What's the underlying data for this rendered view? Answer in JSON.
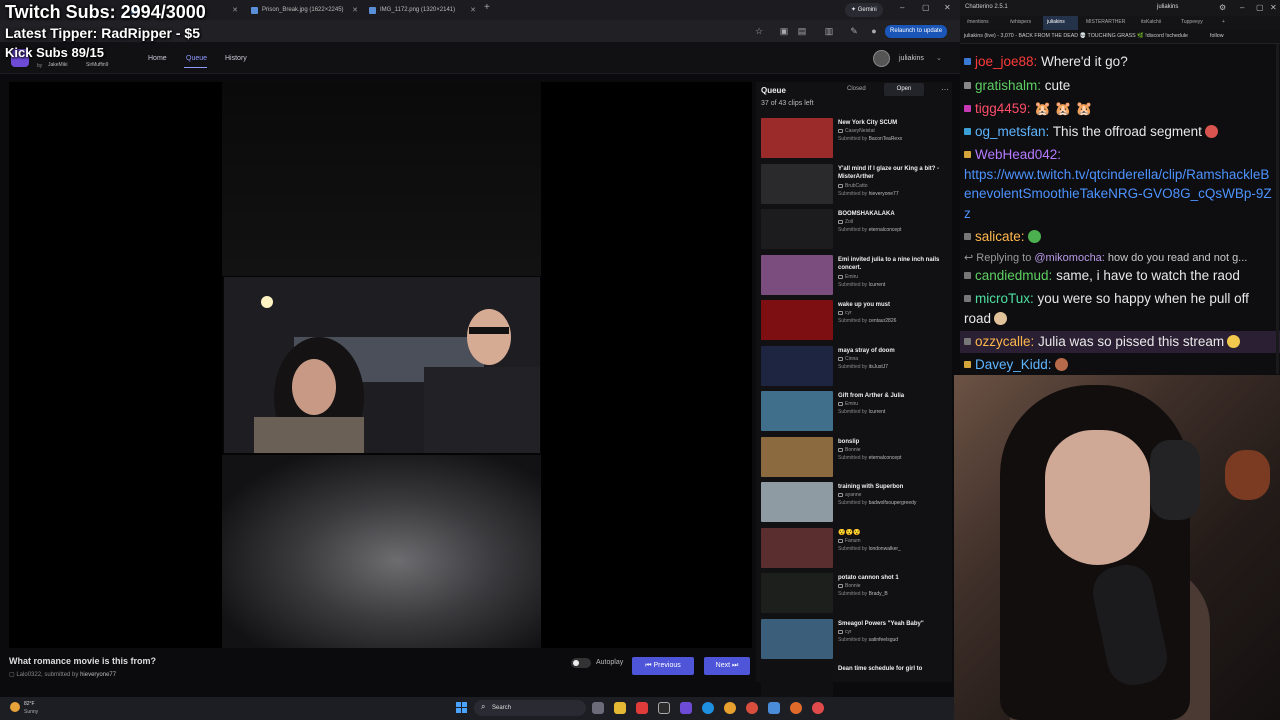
{
  "browser": {
    "tabs": [
      {
        "label": ""
      },
      {
        "label": "Prison_Break.jpg (1622×2245)"
      },
      {
        "label": "IMG_1172.png (1320×2141)"
      }
    ],
    "gemini_label": "Gemini",
    "relaunch_label": "Relaunch to update"
  },
  "overlay": {
    "subs": "Twitch Subs: 2994/3000",
    "tipper": "Latest Tipper: RadRipper - $5",
    "kick": "Kick Subs 89/15"
  },
  "app": {
    "by_label": "by",
    "by_users": [
      "JakeMiki",
      "SirMuffin9"
    ],
    "nav": [
      "Home",
      "Queue",
      "History"
    ],
    "username": "juliakins"
  },
  "clip": {
    "title": "What romance movie is this from?",
    "author": "Lalo0322",
    "submitted_by_label": ", submitted by",
    "submitter": "hieveryone77",
    "autoplay_label": "Autoplay",
    "previous_label": "Previous",
    "next_label": "Next"
  },
  "queue": {
    "title": "Queue",
    "count": "37 of 43 clips left",
    "tab_closed": "Closed",
    "tab_open": "Open",
    "submitted_label": "Submitted by",
    "items": [
      {
        "title": "New York City SCUM",
        "author": "CaseyNeistat",
        "submitter": "BaconTeaRexx",
        "color": "#9b2b2b"
      },
      {
        "title": "Y'all mind if I glaze our King a bit? - MisterArther",
        "author": "BrubCatto",
        "submitter": "hieveryone77",
        "color": "#2a2a2c"
      },
      {
        "title": "BOOMSHAKALAKA",
        "author": "Zoil",
        "submitter": "eternalconcept",
        "color": "#1c1c1e"
      },
      {
        "title": "Emi invited julia to a nine inch nails concert.",
        "author": "Emiru",
        "submitter": "lcurrent",
        "color": "#7a4d7e"
      },
      {
        "title": "wake up you must",
        "author": "cyr",
        "submitter": "centaur2826",
        "color": "#7d0f12"
      },
      {
        "title": "maya stray of doom",
        "author": "Cinna",
        "submitter": "itsJustJ7",
        "color": "#1e2540"
      },
      {
        "title": "Gift from Arther & Julia",
        "author": "Emiru",
        "submitter": "lcurrent",
        "color": "#3f6f8a"
      },
      {
        "title": "bonslip",
        "author": "Bonnie",
        "submitter": "eternalconcept",
        "color": "#8a6a3e"
      },
      {
        "title": "training with Superbon",
        "author": "ayanne",
        "submitter": "badwolfsoupergreedy",
        "color": "#8e9ba3"
      },
      {
        "title": "😯😯😯",
        "author": "Fanum",
        "submitter": "londonwalker_",
        "color": "#5a2e2e"
      },
      {
        "title": "potato cannon shot 1",
        "author": "Bonnie",
        "submitter": "Brady_B",
        "color": "#1c1f1c"
      },
      {
        "title": "Smeagol Powers \"Yeah Baby\"",
        "author": "cyr",
        "submitter": "satinfeelsgud",
        "color": "#3b5f7b"
      },
      {
        "title": "Dean time schedule for girl to",
        "author": "",
        "submitter": "",
        "color": "#101012"
      }
    ]
  },
  "taskbar": {
    "temp": "82°F",
    "condition": "Sunny",
    "search_label": "Search"
  },
  "chat": {
    "app_name": "Chatterino 2.5.1",
    "user": "juliakins",
    "tabs": [
      "/mentions",
      "/whispers",
      "juliakins",
      "MISTERARTHER",
      "itsKatchii",
      "Tuppeeyy"
    ],
    "header": "juliakins (live) - 3,070 - BACK FROM THE DEAD 💀 TOUCHING GRASS 🌿 !discord !schedule",
    "follow_label": "follow",
    "messages": [
      {
        "name": "joe_joe88:",
        "text": "Where'd it go?",
        "name_color": "#ff3b3b",
        "badge": "#3a78d6"
      },
      {
        "name": "gratishalm:",
        "text": "cute",
        "name_color": "#5ecf63",
        "badge": "#888888"
      },
      {
        "name": "tigg4459:",
        "text": "🐹 🐹 🐹",
        "name_color": "#ff4d6a",
        "badge": "#c83ab5"
      },
      {
        "name": "og_metsfan:",
        "text": "This the offroad segment",
        "name_color": "#5fb5ff",
        "badge": "#3aa0d6"
      },
      {
        "name": "WebHead042:",
        "text": "",
        "name_color": "#b57aff",
        "badge": "#d6a63a"
      },
      {
        "name": "",
        "text": "https://www.twitch.tv/qtcinderella/clip/RamshackleBenevolentSmoothieTakeNRG-GVO8G_cQsWBp-9Zz",
        "name_color": "",
        "badge": ""
      },
      {
        "name": "salicate:",
        "text": "",
        "name_color": "#ffb84d",
        "badge": "#777777"
      },
      {
        "name": "candiedmud:",
        "text": "same, i have to watch the raod",
        "name_color": "#5ecf63",
        "badge": "#777777"
      },
      {
        "name": "microTux:",
        "text": "you were so happy when he pull off road",
        "name_color": "#4de0a0",
        "badge": "#777777"
      },
      {
        "name": "ozzycalle:",
        "text": "Julia was so pissed this stream",
        "name_color": "#ffb84d",
        "badge": "#777777"
      },
      {
        "name": "Davey_Kidd:",
        "text": "",
        "name_color": "#5fb5ff",
        "badge": "#d6a63a"
      }
    ],
    "reply": {
      "label": "Replying to",
      "mention": "@mikomocha:",
      "text": "how do you read and not g..."
    }
  }
}
